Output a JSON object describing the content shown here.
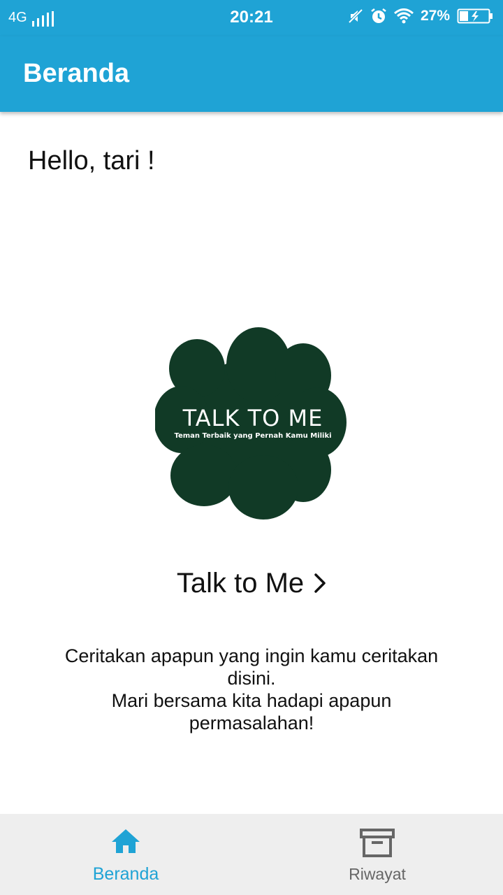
{
  "status_bar": {
    "network": "4G",
    "time": "20:21",
    "battery_percent": "27%",
    "icons": [
      "signal-icon",
      "mute-icon",
      "alarm-icon",
      "wifi-icon",
      "battery-charging-icon"
    ]
  },
  "app_bar": {
    "title": "Beranda"
  },
  "greeting": "Hello, tari !",
  "logo": {
    "title": "TALK TO ME",
    "tagline": "Teman Terbaik yang Pernah Kamu Miliki"
  },
  "cta": {
    "label": "Talk to Me",
    "icon": "chevron-right-icon"
  },
  "description": {
    "line1": "Ceritakan apapun yang ingin kamu ceritakan disini.",
    "line2": "Mari bersama kita hadapi apapun permasalahan!"
  },
  "bottom_nav": {
    "items": [
      {
        "label": "Beranda",
        "icon": "home-icon",
        "active": true
      },
      {
        "label": "Riwayat",
        "icon": "archive-icon",
        "active": false
      }
    ]
  },
  "colors": {
    "primary": "#1fa3d5",
    "logo_fill": "#113a26",
    "nav_background": "#eeeeee"
  }
}
